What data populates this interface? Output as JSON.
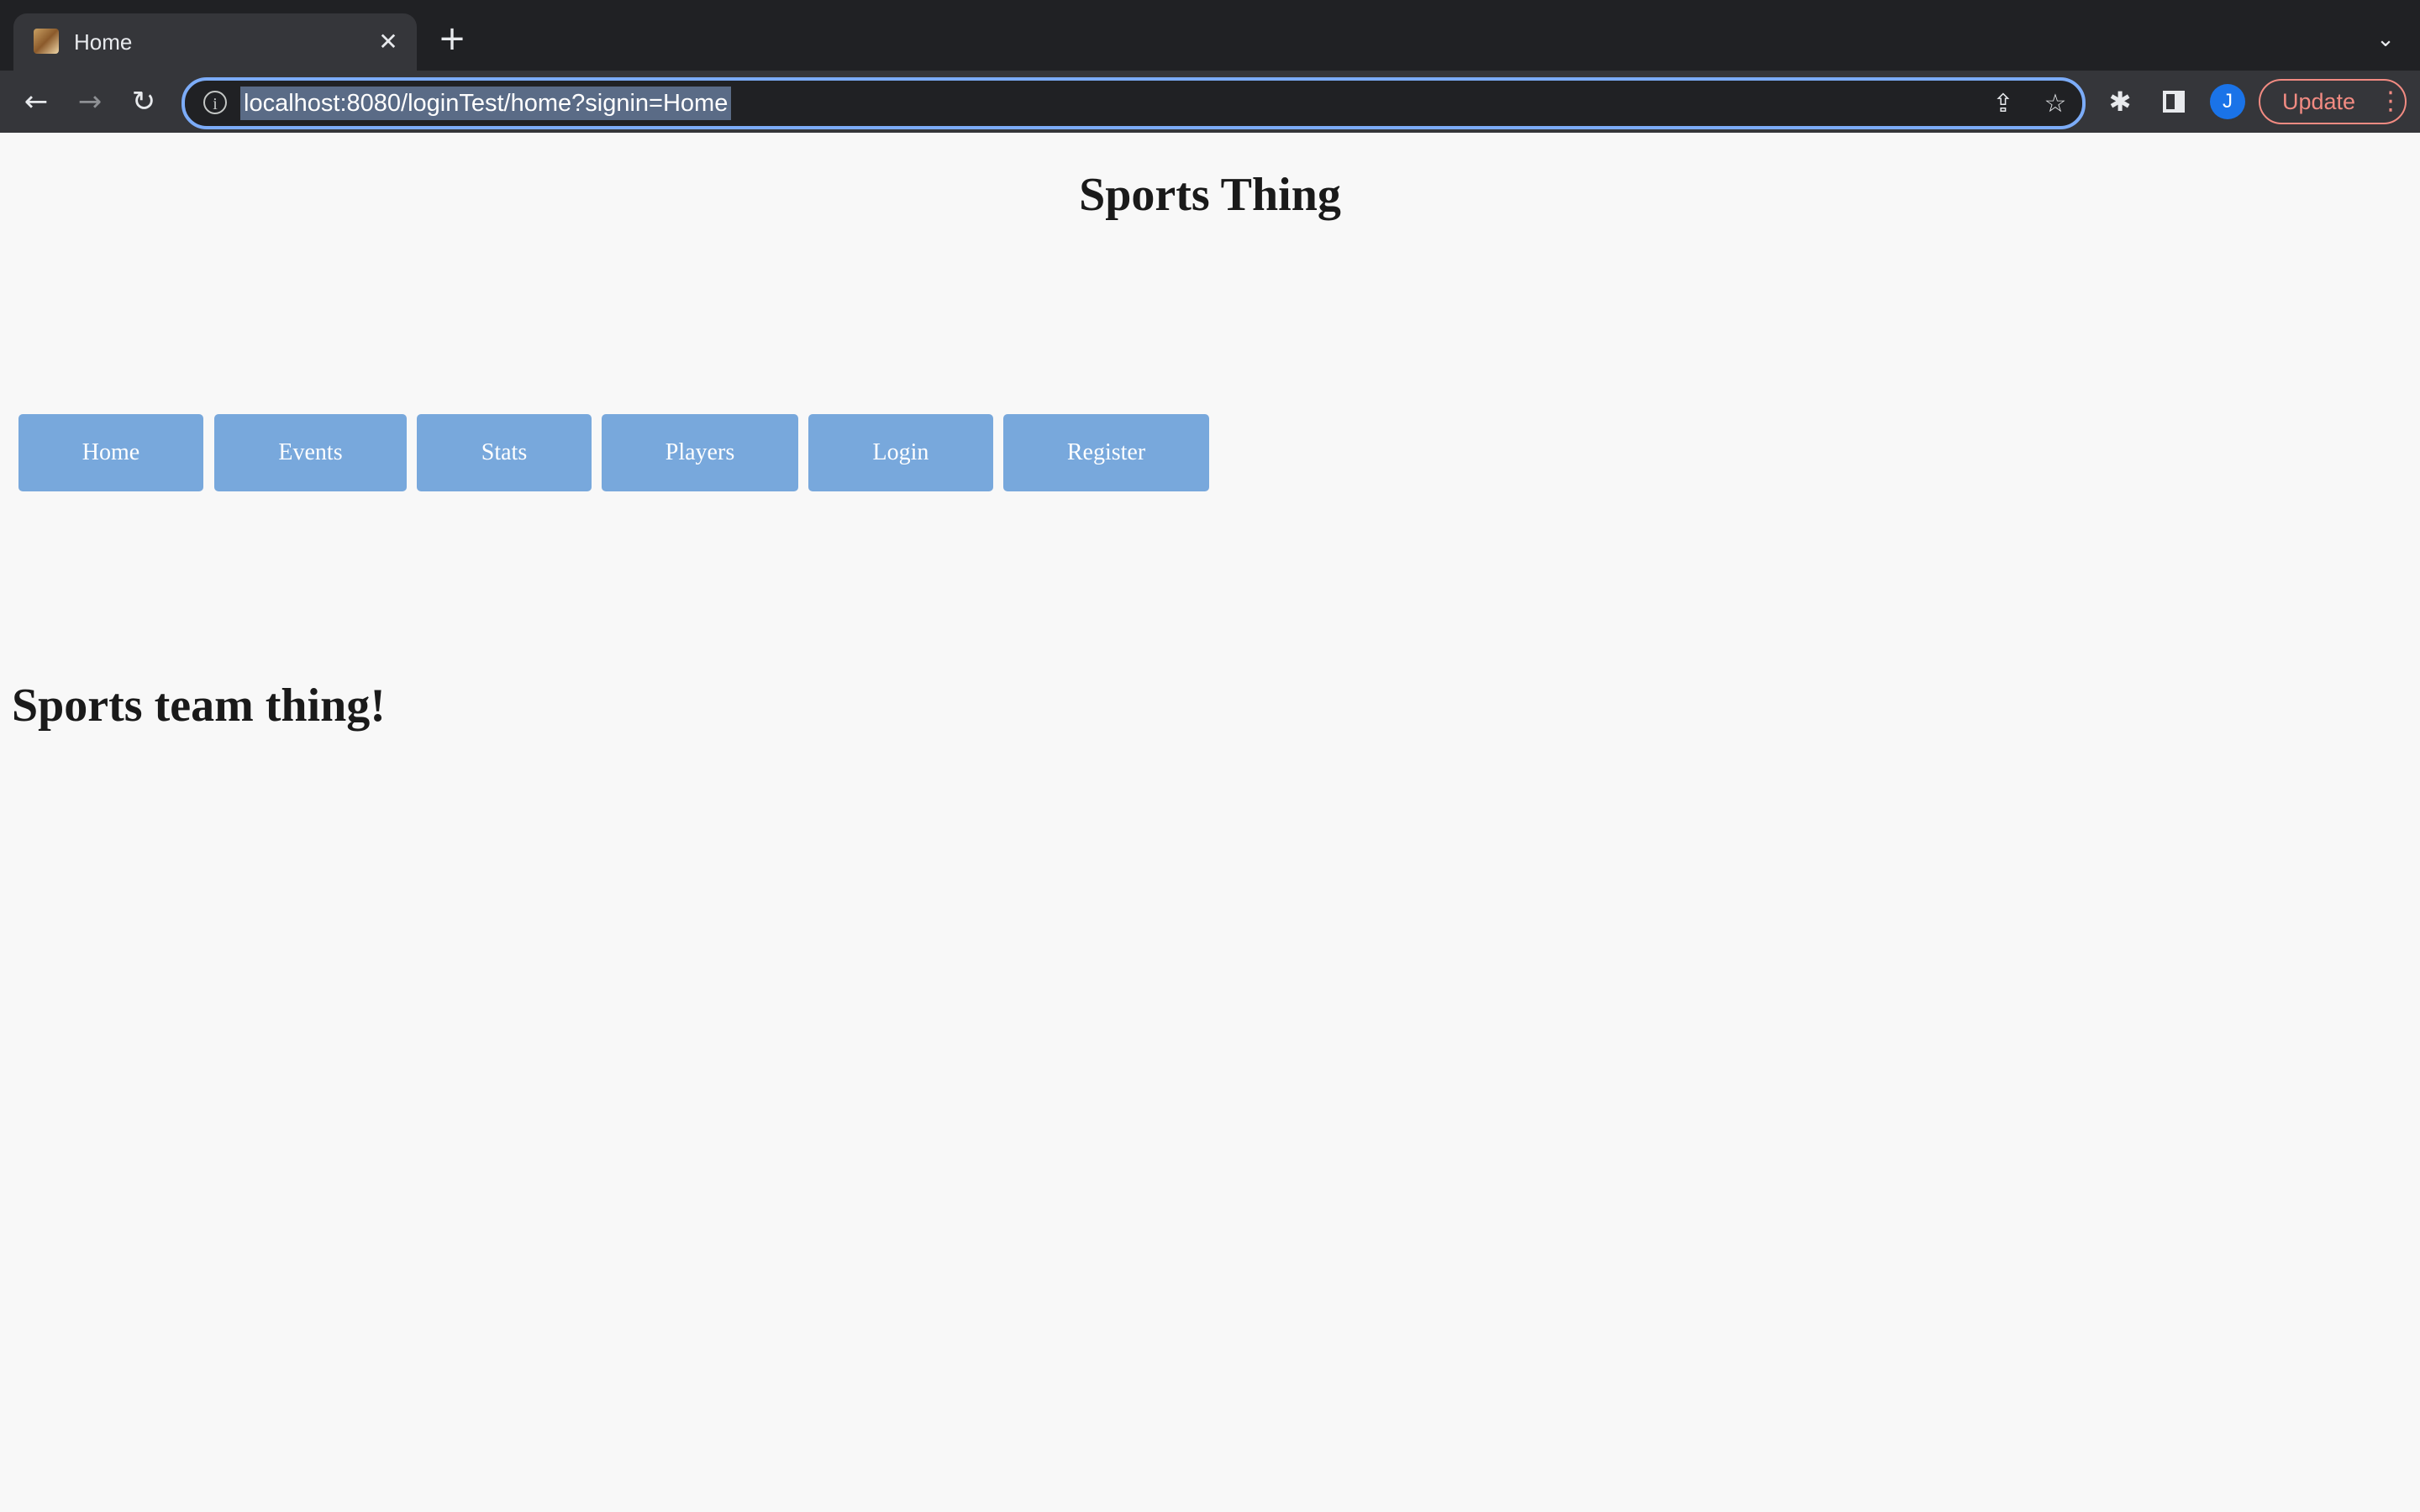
{
  "browser": {
    "tab": {
      "title": "Home",
      "close_icon": "close-icon",
      "favicon": "site-favicon"
    },
    "new_tab_icon": "plus-icon",
    "tab_search_icon": "chevron-down-icon",
    "nav": {
      "back_icon": "arrow-left-icon",
      "forward_icon": "arrow-right-icon",
      "reload_icon": "reload-icon"
    },
    "omnibox": {
      "info_icon": "info-icon",
      "url": "localhost:8080/loginTest/home?signin=Home",
      "share_icon": "share-icon",
      "bookmark_icon": "star-icon"
    },
    "toolbar": {
      "extensions_icon": "puzzle-icon",
      "sidepanel_icon": "side-panel-icon",
      "profile_initial": "J",
      "update_label": "Update",
      "menu_icon": "more-vertical-icon"
    },
    "colors": {
      "chrome_bg": "#202124",
      "toolbar_bg": "#35363a",
      "omnibox_border": "#7cacf8",
      "avatar": "#1a73e8",
      "update": "#f28b82"
    }
  },
  "page": {
    "title": "Sports Thing",
    "nav": [
      {
        "label": "Home"
      },
      {
        "label": "Events"
      },
      {
        "label": "Stats"
      },
      {
        "label": "Players"
      },
      {
        "label": "Login"
      },
      {
        "label": "Register"
      }
    ],
    "headline": "Sports team thing!",
    "colors": {
      "background": "#f8f8f8",
      "nav_button": "#78a8dc",
      "nav_text": "#ffffff",
      "heading": "#1a1a1a"
    }
  }
}
